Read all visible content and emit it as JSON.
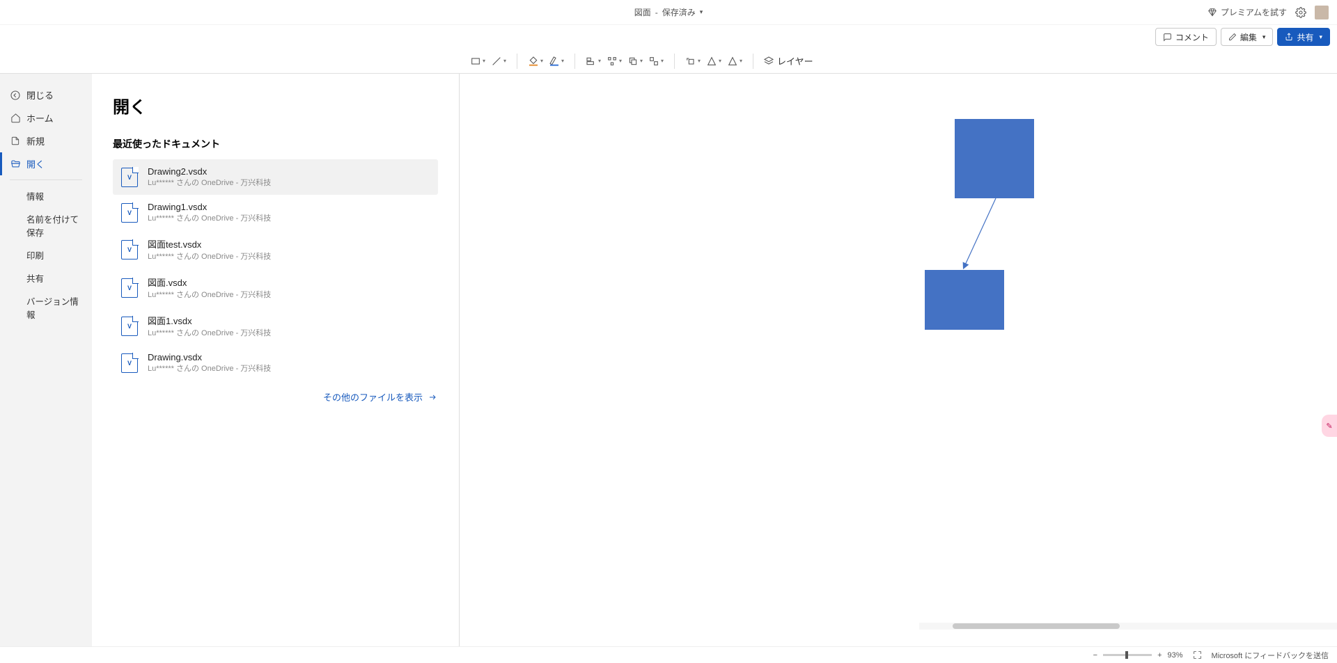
{
  "titlebar": {
    "doc_title": "図面",
    "saved_state": "保存済み",
    "premium_label": "プレミアムを試す"
  },
  "cmdbar": {
    "comment": "コメント",
    "edit": "編集",
    "share": "共有"
  },
  "ribbon": {
    "layer_label": "レイヤー"
  },
  "backstage": {
    "title": "開く",
    "nav": {
      "close": "閉じる",
      "home": "ホーム",
      "new": "新規",
      "open": "開く",
      "info": "情報",
      "saveas": "名前を付けて保存",
      "print": "印刷",
      "shared": "共有",
      "version": "バージョン情報"
    },
    "recent_label": "最近使ったドキュメント",
    "more_files": "その他のファイルを表示",
    "docs": [
      {
        "name": "Drawing2.vsdx",
        "path_prefix": "Lu",
        "path_suffix": "さんの OneDrive - 万兴科技"
      },
      {
        "name": "Drawing1.vsdx",
        "path_prefix": "Lu",
        "path_suffix": "さんの OneDrive - 万兴科技"
      },
      {
        "name": "図面test.vsdx",
        "path_prefix": "Lu",
        "path_suffix": "さんの OneDrive - 万兴科技"
      },
      {
        "name": "図面.vsdx",
        "path_prefix": "Lu",
        "path_suffix": "さんの OneDrive - 万兴科技"
      },
      {
        "name": "図面1.vsdx",
        "path_prefix": "Lu",
        "path_suffix": "さんの OneDrive - 万兴科技"
      },
      {
        "name": "Drawing.vsdx",
        "path_prefix": "Lu",
        "path_suffix": "さんの OneDrive - 万兴科技"
      }
    ]
  },
  "statusbar": {
    "zoom_value": "93%",
    "feedback": "Microsoft にフィードバックを送信"
  },
  "icons": {
    "visio_badge": "V"
  }
}
